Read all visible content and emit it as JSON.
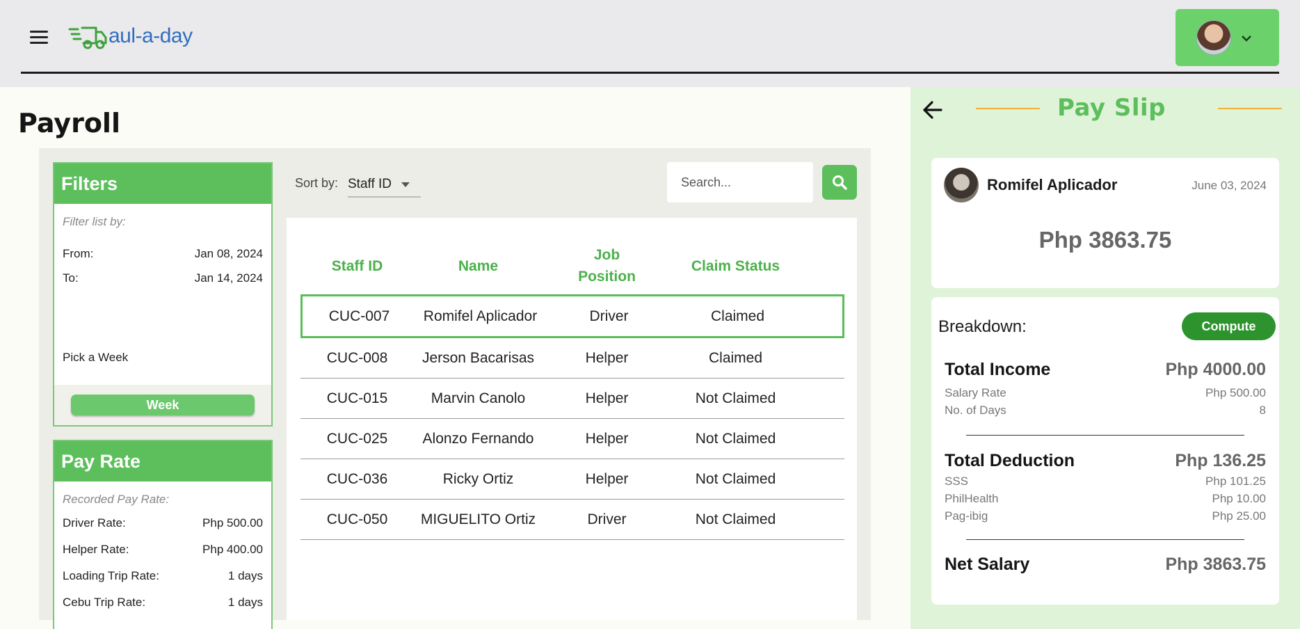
{
  "header": {
    "logo_text": "aul-a-day",
    "menu_icon": "hamburger-menu-icon",
    "user_menu_icon": "chevron-down-icon"
  },
  "page": {
    "title": "Payroll"
  },
  "filters": {
    "title": "Filters",
    "hint": "Filter list by:",
    "from_label": "From:",
    "from_value": "Jan 08, 2024",
    "to_label": "To:",
    "to_value": "Jan 14, 2024",
    "pick_label": "Pick a Week",
    "week_button": "Week"
  },
  "pay_rate": {
    "title": "Pay Rate",
    "hint": "Recorded Pay Rate:",
    "rows": [
      {
        "label": "Driver Rate:",
        "value": "Php 500.00"
      },
      {
        "label": "Helper Rate:",
        "value": "Php 400.00"
      },
      {
        "label": "Loading Trip Rate:",
        "value": "1 days"
      },
      {
        "label": "Cebu Trip Rate:",
        "value": "1 days"
      }
    ]
  },
  "toolbar": {
    "sort_label": "Sort by:",
    "sort_value": "Staff ID",
    "search_placeholder": "Search..."
  },
  "table": {
    "headers": [
      "Staff ID",
      "Name",
      "Job Position",
      "Claim Status"
    ],
    "rows": [
      [
        "CUC-007",
        "Romifel Aplicador",
        "Driver",
        "Claimed"
      ],
      [
        "CUC-008",
        "Jerson Bacarisas",
        "Helper",
        "Claimed"
      ],
      [
        "CUC-015",
        "Marvin Canolo",
        "Helper",
        "Not Claimed"
      ],
      [
        "CUC-025",
        "Alonzo Fernando",
        "Helper",
        "Not Claimed"
      ],
      [
        "CUC-036",
        "Ricky Ortiz",
        "Helper",
        "Not Claimed"
      ],
      [
        "CUC-050",
        "MIGUELITO Ortiz",
        "Driver",
        "Not Claimed"
      ]
    ],
    "selected_index": 0
  },
  "payslip": {
    "title": "Pay Slip",
    "employee_name": "Romifel Aplicador",
    "date": "June 03, 2024",
    "amount": "Php 3863.75",
    "breakdown_label": "Breakdown:",
    "compute_button": "Compute",
    "income": {
      "label": "Total Income",
      "amount": "Php 4000.00",
      "items": [
        {
          "label": "Salary Rate",
          "value": "Php 500.00"
        },
        {
          "label": "No. of Days",
          "value": "8"
        }
      ]
    },
    "deduction": {
      "label": "Total Deduction",
      "amount": "Php 136.25",
      "items": [
        {
          "label": "SSS",
          "value": "Php 101.25"
        },
        {
          "label": "PhilHealth",
          "value": "Php 10.00"
        },
        {
          "label": "Pag-ibig",
          "value": "Php 25.00"
        }
      ]
    },
    "net": {
      "label": "Net Salary",
      "amount": "Php 3863.75"
    }
  },
  "colors": {
    "brand_green": "#5cbf5c",
    "logo_blue": "#2f6ebe",
    "accent_orange": "#f0b23a",
    "compute_green": "#2d932d"
  }
}
